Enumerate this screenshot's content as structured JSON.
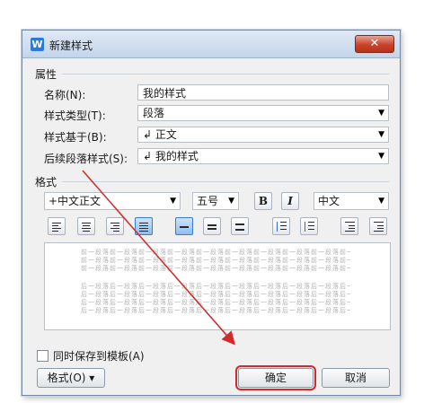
{
  "dialog": {
    "title": "新建样式",
    "app_icon_text": "W",
    "close_symbol": "✕"
  },
  "properties": {
    "section_label": "属性",
    "name_label": "名称(N):",
    "name_value": "我的样式",
    "style_type_label": "样式类型(T):",
    "style_type_value": "段落",
    "based_on_label": "样式基于(B):",
    "based_on_value": "↲ 正文",
    "next_style_label": "后续段落样式(S):",
    "next_style_value": "↲ 我的样式"
  },
  "format": {
    "section_label": "格式",
    "font_value": "+中文正文",
    "size_value": "五号",
    "bold_label": "B",
    "italic_label": "I",
    "lang_value": "中文"
  },
  "preview": {
    "prev_paragraph_text": "前一段落前一段落前一段落前一段落前一段落前一段落前一段落前一段落前一段落前一段落",
    "next_paragraph_text": "后一段落后一段落后一段落后一段落后一段落后一段落后一段落后一段落后一段落后一段落"
  },
  "footer": {
    "save_template_label": "同时保存到模板(A)",
    "format_button_label": "格式(O) ▾",
    "ok_label": "确定",
    "cancel_label": "取消"
  },
  "annotation": {
    "highlight_color": "#d3292a",
    "arrow_color": "#d3292a"
  }
}
